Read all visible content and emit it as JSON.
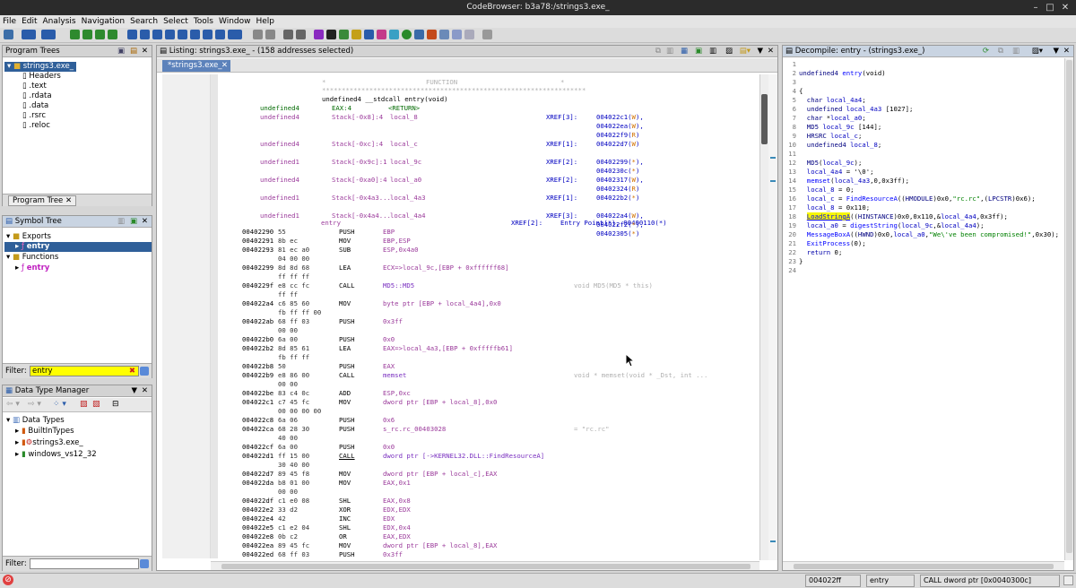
{
  "window": {
    "title": "CodeBrowser: b3a78:/strings3.exe_"
  },
  "menu": [
    "File",
    "Edit",
    "Analysis",
    "Navigation",
    "Search",
    "Select",
    "Tools",
    "Window",
    "Help"
  ],
  "program_trees": {
    "title": "Program Trees",
    "root": "strings3.exe_",
    "children": [
      "Headers",
      ".text",
      ".rdata",
      ".data",
      ".rsrc",
      ".reloc"
    ],
    "tab": "Program Tree"
  },
  "symbol_tree": {
    "title": "Symbol Tree",
    "exports": "Exports",
    "exports_child": "entry",
    "functions": "Functions",
    "functions_child": "entry",
    "filter_label": "Filter:",
    "filter_value": "entry"
  },
  "data_type_manager": {
    "title": "Data Type Manager",
    "root": "Data Types",
    "children": [
      "BuiltInTypes",
      "strings3.exe_",
      "windows_vs12_32"
    ],
    "filter_label": "Filter:"
  },
  "listing": {
    "title": "Listing:  strings3.exe_ - (158 addresses selected)",
    "tab": "*strings3.exe_",
    "header_label": "FUNCTION",
    "stars": "*******************************************************************",
    "signature": "undefined4 __stdcall entry(void)",
    "return_type": "undefined4",
    "return_loc": "EAX:4",
    "return_name": "<RETURN>",
    "locals": [
      {
        "type": "undefined4",
        "loc": "Stack[-0x8]:4",
        "name": "local_8",
        "xref": "XREF[3]:",
        "refs": [
          "004022c1(W),",
          "004022ea(W),",
          "004022f9(R)"
        ]
      },
      {
        "type": "undefined4",
        "loc": "Stack[-0xc]:4",
        "name": "local_c",
        "xref": "XREF[1]:",
        "refs": [
          "004022d7(W)"
        ]
      },
      {
        "type": "undefined1",
        "loc": "Stack[-0x9c]:1",
        "name": "local_9c",
        "xref": "XREF[2]:",
        "refs": [
          "00402299(*),",
          "0040230c(*)"
        ]
      },
      {
        "type": "undefined4",
        "loc": "Stack[-0xa0]:4",
        "name": "local_a0",
        "xref": "XREF[2]:",
        "refs": [
          "00402317(W),",
          "00402324(R)"
        ]
      },
      {
        "type": "undefined1",
        "loc": "Stack[-0x4a3...",
        "name": "local_4a3",
        "xref": "XREF[1]:",
        "refs": [
          "004022b2(*)"
        ]
      },
      {
        "type": "undefined1",
        "loc": "Stack[-0x4a4...",
        "name": "local_4a4",
        "xref": "XREF[3]:",
        "refs": [
          "004022a4(W),",
          "004022f2(*),",
          "00402305(*)"
        ]
      }
    ],
    "label": "entry",
    "label_xref": "XREF[2]:",
    "label_refs": "Entry Point(*), 00400110(*)",
    "instructions": [
      {
        "addr": "00402290",
        "bytes": "55",
        "mn": "PUSH",
        "op": "EBP",
        "cmt": ""
      },
      {
        "addr": "00402291",
        "bytes": "8b ec",
        "mn": "MOV",
        "op": "EBP,ESP",
        "cmt": ""
      },
      {
        "addr": "00402293",
        "bytes": "81 ec a0",
        "mn": "SUB",
        "op": "ESP,0x4a0",
        "cmt": ""
      },
      {
        "addr": "",
        "bytes": "04 00 00",
        "mn": "",
        "op": "",
        "cmt": ""
      },
      {
        "addr": "00402299",
        "bytes": "8d 8d 68",
        "mn": "LEA",
        "op": "ECX=>local_9c,[EBP + 0xffffff68]",
        "cmt": ""
      },
      {
        "addr": "",
        "bytes": "ff ff ff",
        "mn": "",
        "op": "",
        "cmt": ""
      },
      {
        "addr": "0040229f",
        "bytes": "e8 cc fc",
        "mn": "CALL",
        "op": "MD5::MD5",
        "cmt": "void MD5(MD5 * this)"
      },
      {
        "addr": "",
        "bytes": "ff ff",
        "mn": "",
        "op": "",
        "cmt": ""
      },
      {
        "addr": "004022a4",
        "bytes": "c6 85 60",
        "mn": "MOV",
        "op": "byte ptr [EBP + local_4a4],0x0",
        "cmt": ""
      },
      {
        "addr": "",
        "bytes": "fb ff ff 00",
        "mn": "",
        "op": "",
        "cmt": ""
      },
      {
        "addr": "004022ab",
        "bytes": "68 ff 03",
        "mn": "PUSH",
        "op": "0x3ff",
        "cmt": ""
      },
      {
        "addr": "",
        "bytes": "00 00",
        "mn": "",
        "op": "",
        "cmt": ""
      },
      {
        "addr": "004022b0",
        "bytes": "6a 00",
        "mn": "PUSH",
        "op": "0x0",
        "cmt": ""
      },
      {
        "addr": "004022b2",
        "bytes": "8d 85 61",
        "mn": "LEA",
        "op": "EAX=>local_4a3,[EBP + 0xfffffb61]",
        "cmt": ""
      },
      {
        "addr": "",
        "bytes": "fb ff ff",
        "mn": "",
        "op": "",
        "cmt": ""
      },
      {
        "addr": "004022b8",
        "bytes": "50",
        "mn": "PUSH",
        "op": "EAX",
        "cmt": ""
      },
      {
        "addr": "004022b9",
        "bytes": "e8 86 00",
        "mn": "CALL",
        "op": "memset",
        "cmt": "void * memset(void * _Dst, int ..."
      },
      {
        "addr": "",
        "bytes": "00 00",
        "mn": "",
        "op": "",
        "cmt": ""
      },
      {
        "addr": "004022be",
        "bytes": "83 c4 0c",
        "mn": "ADD",
        "op": "ESP,0xc",
        "cmt": ""
      },
      {
        "addr": "004022c1",
        "bytes": "c7 45 fc",
        "mn": "MOV",
        "op": "dword ptr [EBP + local_8],0x0",
        "cmt": ""
      },
      {
        "addr": "",
        "bytes": "00 00 00 00",
        "mn": "",
        "op": "",
        "cmt": ""
      },
      {
        "addr": "004022c8",
        "bytes": "6a 06",
        "mn": "PUSH",
        "op": "0x6",
        "cmt": ""
      },
      {
        "addr": "004022ca",
        "bytes": "68 28 30",
        "mn": "PUSH",
        "op": "s_rc.rc_00403028",
        "cmt": "= \"rc.rc\""
      },
      {
        "addr": "",
        "bytes": "40 00",
        "mn": "",
        "op": "",
        "cmt": ""
      },
      {
        "addr": "004022cf",
        "bytes": "6a 00",
        "mn": "PUSH",
        "op": "0x0",
        "cmt": ""
      },
      {
        "addr": "004022d1",
        "bytes": "ff 15 00",
        "mn": "CALL",
        "op": "dword ptr [->KERNEL32.DLL::FindResourceA]",
        "cmt": ""
      },
      {
        "addr": "",
        "bytes": "30 40 00",
        "mn": "",
        "op": "",
        "cmt": ""
      },
      {
        "addr": "004022d7",
        "bytes": "89 45 f8",
        "mn": "MOV",
        "op": "dword ptr [EBP + local_c],EAX",
        "cmt": ""
      },
      {
        "addr": "004022da",
        "bytes": "b8 01 00",
        "mn": "MOV",
        "op": "EAX,0x1",
        "cmt": ""
      },
      {
        "addr": "",
        "bytes": "00 00",
        "mn": "",
        "op": "",
        "cmt": ""
      },
      {
        "addr": "004022df",
        "bytes": "c1 e0 08",
        "mn": "SHL",
        "op": "EAX,0x8",
        "cmt": ""
      },
      {
        "addr": "004022e2",
        "bytes": "33 d2",
        "mn": "XOR",
        "op": "EDX,EDX",
        "cmt": ""
      },
      {
        "addr": "004022e4",
        "bytes": "42",
        "mn": "INC",
        "op": "EDX",
        "cmt": ""
      },
      {
        "addr": "004022e5",
        "bytes": "c1 e2 04",
        "mn": "SHL",
        "op": "EDX,0x4",
        "cmt": ""
      },
      {
        "addr": "004022e8",
        "bytes": "0b c2",
        "mn": "OR",
        "op": "EAX,EDX",
        "cmt": ""
      },
      {
        "addr": "004022ea",
        "bytes": "89 45 fc",
        "mn": "MOV",
        "op": "dword ptr [EBP + local_8],EAX",
        "cmt": ""
      },
      {
        "addr": "004022ed",
        "bytes": "68 ff 03",
        "mn": "PUSH",
        "op": "0x3ff",
        "cmt": ""
      }
    ]
  },
  "decompiler": {
    "title": "Decompile: entry - (strings3.exe_)",
    "lines": [
      "",
      "undefined4 entry(void)",
      "",
      "{",
      "  char local_4a4;",
      "  undefined local_4a3 [1027];",
      "  char *local_a0;",
      "  MD5 local_9c [144];",
      "  HRSRC local_c;",
      "  undefined4 local_8;",
      "",
      "  MD5(local_9c);",
      "  local_4a4 = '\\0';",
      "  memset(local_4a3,0,0x3ff);",
      "  local_8 = 0;",
      "  local_c = FindResourceA((HMODULE)0x0,\"rc.rc\",(LPCSTR)0x6);",
      "  local_8 = 0x110;",
      "  LoadStringA((HINSTANCE)0x0,0x110,&local_4a4,0x3ff);",
      "  local_a0 = digestString(local_9c,&local_4a4);",
      "  MessageBoxA((HWND)0x0,local_a0,\"We\\'ve been compromised!\",0x30);",
      "  ExitProcess(0);",
      "  return 0;",
      "}",
      ""
    ]
  },
  "status": {
    "address": "004022ff",
    "function": "entry",
    "instruction": "CALL dword ptr [0x0040300c]"
  }
}
